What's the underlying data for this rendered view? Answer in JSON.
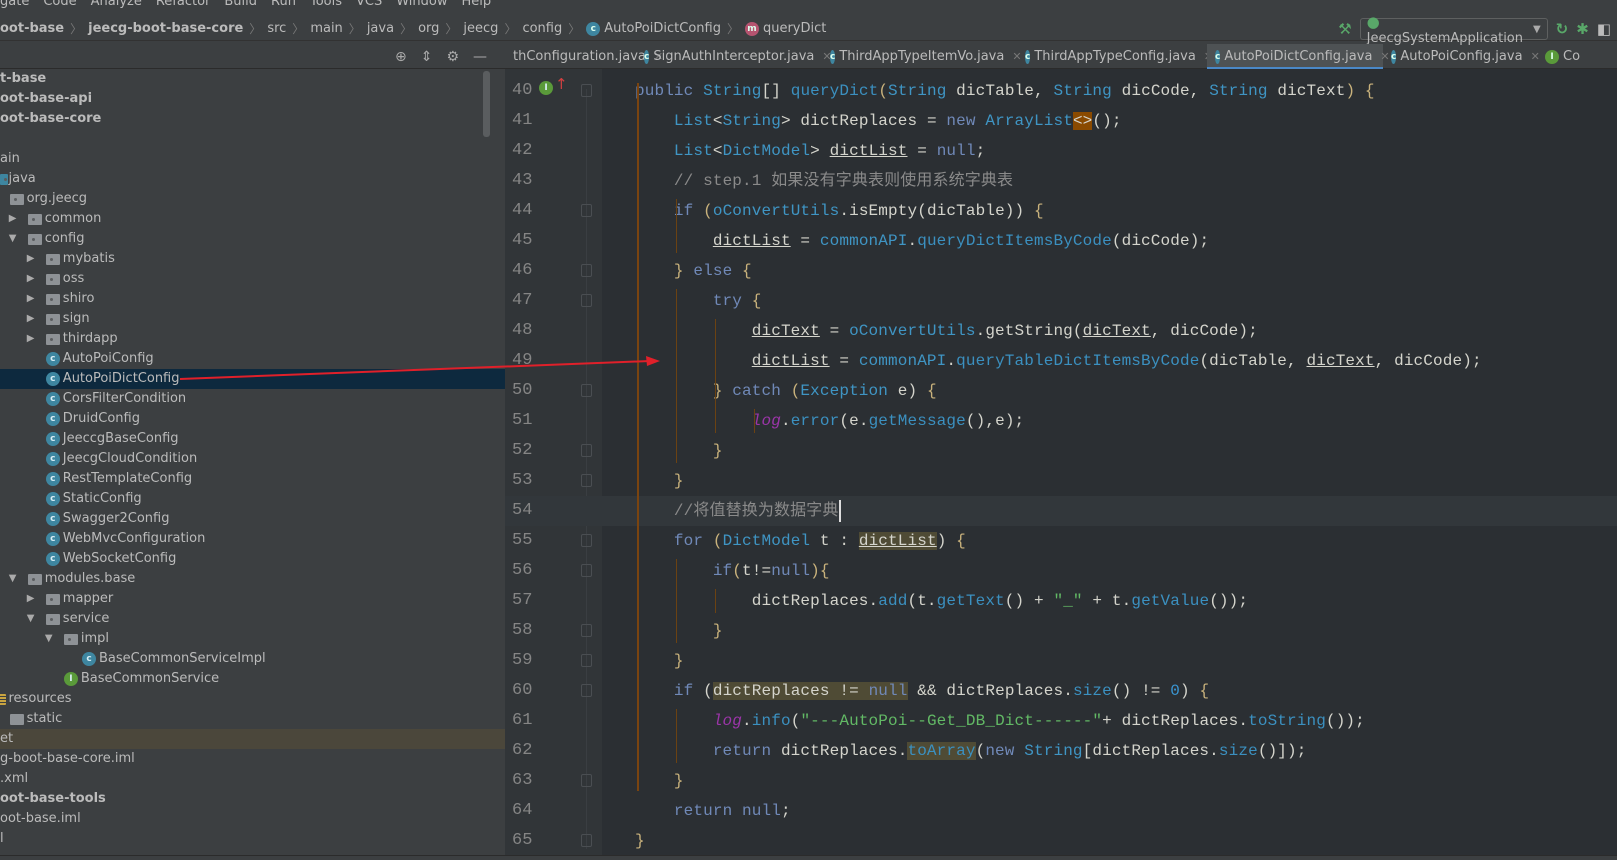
{
  "menu": [
    "gate",
    "Code",
    "Analyze",
    "Refactor",
    "Build",
    "Run",
    "Tools",
    "VCS",
    "Window",
    "Help"
  ],
  "breadcrumb": [
    {
      "label": "oot-base",
      "bold": true
    },
    {
      "label": "jeecg-boot-base-core",
      "bold": true
    },
    {
      "label": "src"
    },
    {
      "label": "main"
    },
    {
      "label": "java"
    },
    {
      "label": "org"
    },
    {
      "label": "jeecg"
    },
    {
      "label": "config"
    },
    {
      "label": "AutoPoiDictConfig",
      "icon": "class"
    },
    {
      "label": "queryDict",
      "icon": "method"
    }
  ],
  "run_config": {
    "label": "JeecgSystemApplication",
    "icons": [
      "hammer-icon",
      "rerun-icon",
      "debug-icon",
      "coverage-icon"
    ]
  },
  "tabs": [
    {
      "label": "thConfiguration.java",
      "icon": "none"
    },
    {
      "label": "SignAuthInterceptor.java",
      "icon": "class"
    },
    {
      "label": "ThirdAppTypeItemVo.java",
      "icon": "class"
    },
    {
      "label": "ThirdAppTypeConfig.java",
      "icon": "class"
    },
    {
      "label": "AutoPoiDictConfig.java",
      "icon": "class",
      "active": true
    },
    {
      "label": "AutoPoiConfig.java",
      "icon": "class"
    },
    {
      "label": "Co",
      "icon": "interface"
    }
  ],
  "tree": [
    {
      "label": "t-base",
      "level": -1,
      "bold": true
    },
    {
      "label": "oot-base-api",
      "level": -1,
      "bold": true
    },
    {
      "label": "oot-base-core",
      "level": -1,
      "bold": true
    },
    {
      "label": "",
      "level": -1
    },
    {
      "label": "ain",
      "level": -1
    },
    {
      "label": "java",
      "level": 0,
      "icon": "src"
    },
    {
      "label": "org.jeecg",
      "level": 1,
      "icon": "package"
    },
    {
      "label": "common",
      "level": 2,
      "icon": "package",
      "arrow": "closed"
    },
    {
      "label": "config",
      "level": 2,
      "icon": "package",
      "arrow": "open"
    },
    {
      "label": "mybatis",
      "level": 3,
      "icon": "package",
      "arrow": "closed"
    },
    {
      "label": "oss",
      "level": 3,
      "icon": "package",
      "arrow": "closed"
    },
    {
      "label": "shiro",
      "level": 3,
      "icon": "package",
      "arrow": "closed"
    },
    {
      "label": "sign",
      "level": 3,
      "icon": "package",
      "arrow": "closed"
    },
    {
      "label": "thirdapp",
      "level": 3,
      "icon": "package",
      "arrow": "closed"
    },
    {
      "label": "AutoPoiConfig",
      "level": 3,
      "icon": "class"
    },
    {
      "label": "AutoPoiDictConfig",
      "level": 3,
      "icon": "class",
      "selected": true
    },
    {
      "label": "CorsFilterCondition",
      "level": 3,
      "icon": "class"
    },
    {
      "label": "DruidConfig",
      "level": 3,
      "icon": "class"
    },
    {
      "label": "JeeccgBaseConfig",
      "level": 3,
      "icon": "class"
    },
    {
      "label": "JeecgCloudCondition",
      "level": 3,
      "icon": "class"
    },
    {
      "label": "RestTemplateConfig",
      "level": 3,
      "icon": "class"
    },
    {
      "label": "StaticConfig",
      "level": 3,
      "icon": "class"
    },
    {
      "label": "Swagger2Config",
      "level": 3,
      "icon": "class"
    },
    {
      "label": "WebMvcConfiguration",
      "level": 3,
      "icon": "class"
    },
    {
      "label": "WebSocketConfig",
      "level": 3,
      "icon": "class"
    },
    {
      "label": "modules.base",
      "level": 2,
      "icon": "package",
      "arrow": "open"
    },
    {
      "label": "mapper",
      "level": 3,
      "icon": "package",
      "arrow": "closed"
    },
    {
      "label": "service",
      "level": 3,
      "icon": "package",
      "arrow": "open"
    },
    {
      "label": "impl",
      "level": 4,
      "icon": "package",
      "arrow": "open"
    },
    {
      "label": "BaseCommonServiceImpl",
      "level": 5,
      "icon": "class"
    },
    {
      "label": "BaseCommonService",
      "level": 4,
      "icon": "interface"
    },
    {
      "label": "resources",
      "level": 0,
      "icon": "resources"
    },
    {
      "label": "static",
      "level": 1,
      "icon": "folder"
    },
    {
      "label": "et",
      "level": -1,
      "highlight": true
    },
    {
      "label": "g-boot-base-core.iml",
      "level": -1
    },
    {
      "label": ".xml",
      "level": -1
    },
    {
      "label": "oot-base-tools",
      "level": -1,
      "bold": true
    },
    {
      "label": "oot-base.iml",
      "level": -1
    },
    {
      "label": "l",
      "level": -1
    }
  ],
  "editor": {
    "first_line": 40,
    "current_line": 54,
    "lines": [
      {
        "indent": 0,
        "t": [
          [
            "kw",
            "public "
          ],
          [
            "ty",
            "String"
          ],
          [
            "id",
            "[] "
          ],
          [
            "fn",
            "queryDict"
          ],
          [
            "br",
            "("
          ],
          [
            "ty",
            "String"
          ],
          [
            "id",
            " dicTable, "
          ],
          [
            "ty",
            "String"
          ],
          [
            "id",
            " dicCode, "
          ],
          [
            "ty",
            "String"
          ],
          [
            "id",
            " dicText"
          ],
          [
            "br",
            ") {"
          ]
        ]
      },
      {
        "indent": 1,
        "t": [
          [
            "ty",
            "List"
          ],
          [
            "id",
            "<"
          ],
          [
            "ty",
            "String"
          ],
          [
            "id",
            "> dictReplaces = "
          ],
          [
            "kw",
            "new "
          ],
          [
            "ty",
            "ArrayList"
          ],
          [
            "hlo",
            "<>"
          ],
          [
            "id",
            "();"
          ]
        ]
      },
      {
        "indent": 1,
        "t": [
          [
            "ty",
            "List"
          ],
          [
            "id",
            "<"
          ],
          [
            "ty",
            "DictModel"
          ],
          [
            "id",
            "> "
          ],
          [
            "u",
            "dictList"
          ],
          [
            "id",
            " = "
          ],
          [
            "kw",
            "null"
          ],
          [
            "id",
            ";"
          ]
        ]
      },
      {
        "indent": 1,
        "t": [
          [
            "cm",
            "// step.1 如果没有字典表则使用系统字典表"
          ]
        ]
      },
      {
        "indent": 1,
        "t": [
          [
            "kw",
            "if "
          ],
          [
            "br",
            "("
          ],
          [
            "ty",
            "oConvertUtils"
          ],
          [
            "id",
            ".isEmpty(dicTable)) "
          ],
          [
            "br",
            "{"
          ]
        ]
      },
      {
        "indent": 2,
        "t": [
          [
            "u",
            "dictList"
          ],
          [
            "id",
            " = "
          ],
          [
            "ty",
            "commonAPI"
          ],
          [
            "id",
            "."
          ],
          [
            "fn",
            "queryDictItemsByCode"
          ],
          [
            "id",
            "(dicCode);"
          ]
        ]
      },
      {
        "indent": 1,
        "t": [
          [
            "br",
            "} "
          ],
          [
            "kw",
            "else "
          ],
          [
            "br",
            "{"
          ]
        ]
      },
      {
        "indent": 2,
        "t": [
          [
            "kw",
            "try "
          ],
          [
            "br",
            "{"
          ]
        ]
      },
      {
        "indent": 3,
        "t": [
          [
            "u",
            "dicText"
          ],
          [
            "id",
            " = "
          ],
          [
            "ty",
            "oConvertUtils"
          ],
          [
            "id",
            ".getString("
          ],
          [
            "u",
            "dicText"
          ],
          [
            "id",
            ", dicCode);"
          ]
        ]
      },
      {
        "indent": 3,
        "t": [
          [
            "u",
            "dictList"
          ],
          [
            "id",
            " = "
          ],
          [
            "ty",
            "commonAPI"
          ],
          [
            "id",
            "."
          ],
          [
            "fn",
            "queryTableDictItemsByCode"
          ],
          [
            "id",
            "(dicTable, "
          ],
          [
            "u",
            "dicText"
          ],
          [
            "id",
            ", dicCode);"
          ]
        ]
      },
      {
        "indent": 2,
        "t": [
          [
            "br",
            "} "
          ],
          [
            "kw",
            "catch "
          ],
          [
            "br",
            "("
          ],
          [
            "ty",
            "Exception"
          ],
          [
            "id",
            " e) "
          ],
          [
            "br",
            "{"
          ]
        ]
      },
      {
        "indent": 3,
        "t": [
          [
            "log",
            "log"
          ],
          [
            "id",
            "."
          ],
          [
            "fn",
            "error"
          ],
          [
            "id",
            "(e."
          ],
          [
            "fn",
            "getMessage"
          ],
          [
            "id",
            "(),e);"
          ]
        ]
      },
      {
        "indent": 2,
        "t": [
          [
            "br",
            "}"
          ]
        ]
      },
      {
        "indent": 1,
        "t": [
          [
            "br",
            "}"
          ]
        ]
      },
      {
        "indent": 1,
        "t": [
          [
            "cm",
            "//将值替换为数据字典"
          ]
        ],
        "caret": true
      },
      {
        "indent": 1,
        "t": [
          [
            "kw",
            "for "
          ],
          [
            "br",
            "("
          ],
          [
            "ty",
            "DictModel"
          ],
          [
            "id",
            " t : "
          ],
          [
            "u hly",
            "dictList"
          ],
          [
            "id",
            ") "
          ],
          [
            "br",
            "{"
          ]
        ]
      },
      {
        "indent": 2,
        "t": [
          [
            "kw",
            "if"
          ],
          [
            "br",
            "("
          ],
          [
            "id",
            "t!="
          ],
          [
            "kw",
            "null"
          ],
          [
            "br",
            "){"
          ]
        ]
      },
      {
        "indent": 3,
        "t": [
          [
            "id",
            "dictReplaces."
          ],
          [
            "fn",
            "add"
          ],
          [
            "id",
            "(t."
          ],
          [
            "fn",
            "getText"
          ],
          [
            "id",
            "() + "
          ],
          [
            "str",
            "\"_\""
          ],
          [
            "id",
            " + t."
          ],
          [
            "fn",
            "getValue"
          ],
          [
            "id",
            "());"
          ]
        ]
      },
      {
        "indent": 2,
        "t": [
          [
            "br",
            "}"
          ]
        ]
      },
      {
        "indent": 1,
        "t": [
          [
            "br",
            "}"
          ]
        ]
      },
      {
        "indent": 1,
        "t": [
          [
            "kw",
            "if "
          ],
          [
            "id",
            "("
          ],
          [
            "id hly",
            "dictReplaces != "
          ],
          [
            "kw hly",
            "null"
          ],
          [
            "id",
            " && dictReplaces."
          ],
          [
            "fn",
            "size"
          ],
          [
            "id",
            "() != "
          ],
          [
            "num",
            "0"
          ],
          [
            "id",
            ") "
          ],
          [
            "br",
            "{"
          ]
        ]
      },
      {
        "indent": 2,
        "t": [
          [
            "log",
            "log"
          ],
          [
            "id",
            "."
          ],
          [
            "fn",
            "info"
          ],
          [
            "id",
            "("
          ],
          [
            "str",
            "\"---AutoPoi--Get_DB_Dict------\""
          ],
          [
            "id",
            "+ dictReplaces."
          ],
          [
            "fn",
            "toString"
          ],
          [
            "id",
            "());"
          ]
        ]
      },
      {
        "indent": 2,
        "t": [
          [
            "kw",
            "return "
          ],
          [
            "id",
            "dictReplaces."
          ],
          [
            "fn hly",
            "toArray"
          ],
          [
            "id",
            "("
          ],
          [
            "kw",
            "new "
          ],
          [
            "ty",
            "String"
          ],
          [
            "id",
            "[dictReplaces."
          ],
          [
            "fn",
            "size"
          ],
          [
            "id",
            "()]);"
          ]
        ]
      },
      {
        "indent": 1,
        "t": [
          [
            "br",
            "}"
          ]
        ]
      },
      {
        "indent": 1,
        "t": [
          [
            "kw",
            "return null"
          ],
          [
            "id",
            ";"
          ]
        ]
      },
      {
        "indent": 0,
        "t": [
          [
            "br",
            "}"
          ]
        ]
      }
    ]
  },
  "colors": {
    "annotation_arrow": "#e0202a",
    "selection": "#0d293e",
    "accent": "#4a88c7"
  }
}
